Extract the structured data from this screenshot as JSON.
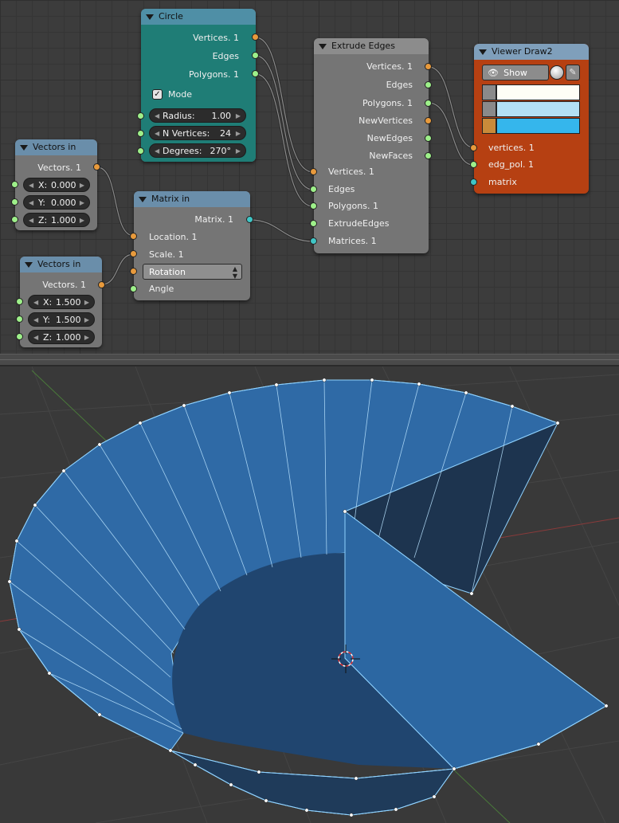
{
  "nodes": {
    "circle": {
      "title": "Circle",
      "outputs": [
        "Vertices. 1",
        "Edges",
        "Polygons. 1"
      ],
      "mode_label": "Mode",
      "mode_checked": true,
      "fields": [
        {
          "label": "Radius:",
          "value": "1.00"
        },
        {
          "label": "N Vertices:",
          "value": "24"
        },
        {
          "label": "Degrees:",
          "value": "270°"
        }
      ],
      "color": "#1f7d76"
    },
    "vectors_in_1": {
      "title": "Vectors in",
      "output": "Vectors. 1",
      "fields": [
        {
          "label": "X:",
          "value": "0.000"
        },
        {
          "label": "Y:",
          "value": "0.000"
        },
        {
          "label": "Z:",
          "value": "1.000"
        }
      ]
    },
    "vectors_in_2": {
      "title": "Vectors in",
      "output": "Vectors. 1",
      "fields": [
        {
          "label": "X:",
          "value": "1.500"
        },
        {
          "label": "Y:",
          "value": "1.500"
        },
        {
          "label": "Z:",
          "value": "1.000"
        }
      ]
    },
    "matrix_in": {
      "title": "Matrix in",
      "output": "Matrix. 1",
      "inputs": [
        "Location. 1",
        "Scale. 1",
        "Angle"
      ],
      "rotation_label": "Rotation"
    },
    "extrude_edges": {
      "title": "Extrude Edges",
      "outputs": [
        "Vertices. 1",
        "Edges",
        "Polygons. 1",
        "NewVertices",
        "NewEdges",
        "NewFaces"
      ],
      "inputs": [
        "Vertices. 1",
        "Edges",
        "Polygons. 1",
        "ExtrudeEdges",
        "Matrices. 1"
      ]
    },
    "viewer_draw": {
      "title": "Viewer Draw2",
      "show_label": "Show",
      "inputs": [
        "vertices. 1",
        "edg_pol. 1",
        "matrix"
      ],
      "colors": [
        "#fefef6",
        "#b3e0f4",
        "#35b6ec"
      ],
      "color": "#b64012"
    }
  },
  "viewport": {
    "mesh_color": "#2d6aa6",
    "edge_color": "#8fd2ff"
  }
}
